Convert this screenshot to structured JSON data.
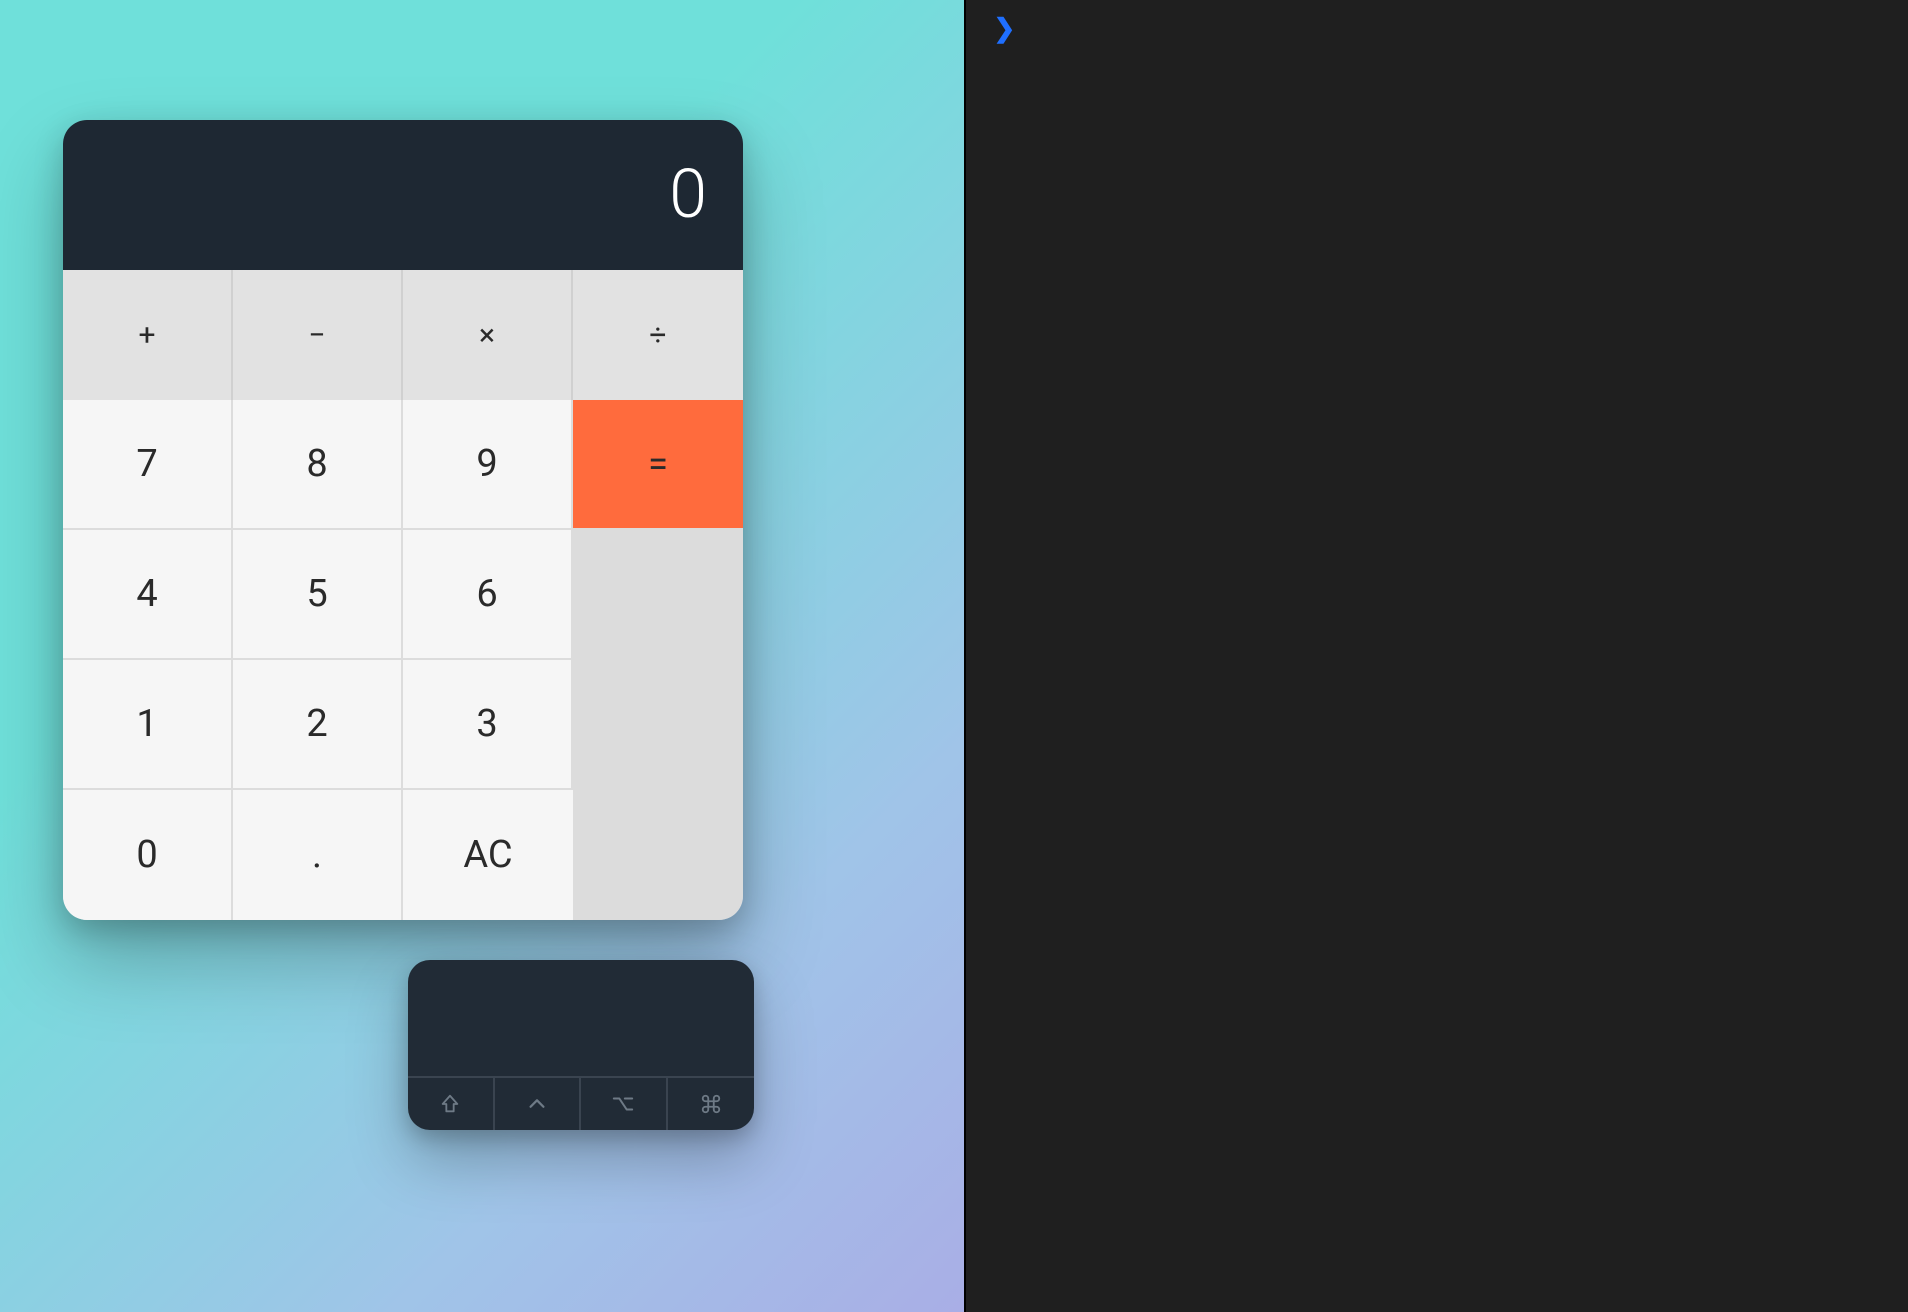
{
  "terminal": {
    "prompt": "❯"
  },
  "calculator": {
    "display": "0",
    "operators": {
      "add": "+",
      "subtract": "−",
      "multiply": "×",
      "divide": "÷"
    },
    "digits": {
      "d7": "7",
      "d8": "8",
      "d9": "9",
      "d4": "4",
      "d5": "5",
      "d6": "6",
      "d1": "1",
      "d2": "2",
      "d3": "3",
      "d0": "0",
      "dot": ".",
      "clear": "AC"
    },
    "equals": "="
  },
  "modifiers": {
    "shift": "shift",
    "ctrl": "ctrl",
    "opt": "opt",
    "cmd": "cmd"
  }
}
